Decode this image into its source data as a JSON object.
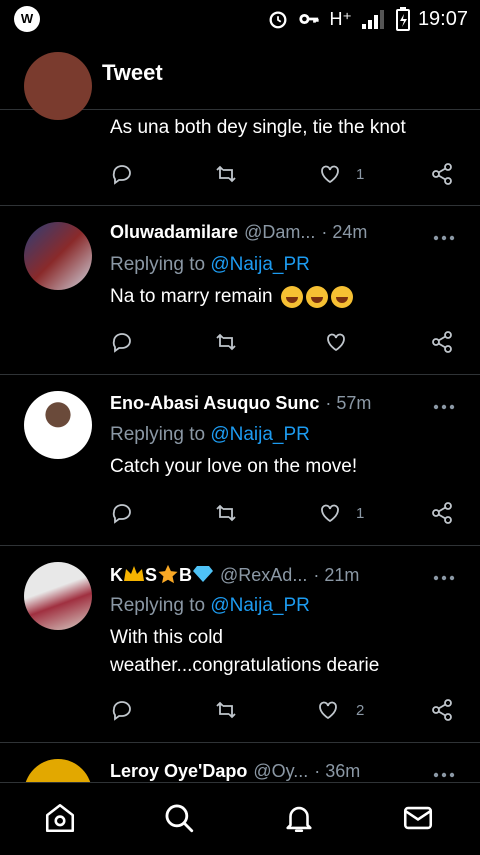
{
  "status": {
    "time": "19:07",
    "network": "H⁺",
    "app_badge": "W"
  },
  "header": {
    "title": "Tweet"
  },
  "partial_tweet": {
    "text": "As una both dey single, tie the knot",
    "like_count": "1"
  },
  "tweets": [
    {
      "name": "Oluwadamilare",
      "handle": "@Dam...",
      "time": "· 24m",
      "reply_prefix": "Replying to",
      "reply_to": "@Naija_PR",
      "text": "Na to marry remain",
      "like_count": ""
    },
    {
      "name": "Eno-Abasi Asuquo Sunc",
      "handle": "",
      "time": "· 57m",
      "reply_prefix": "Replying to",
      "reply_to": "@Naija_PR",
      "text": "Catch your love on the move!",
      "like_count": "1"
    },
    {
      "name_parts": [
        "K",
        "S",
        "B"
      ],
      "handle": "@RexAd...",
      "time": "· 21m",
      "reply_prefix": "Replying to",
      "reply_to": "@Naija_PR",
      "text": "With this cold weather...congratulations dearie",
      "like_count": "2"
    },
    {
      "name": "Leroy Oye'Dapo",
      "handle": "@Oy...",
      "time": "· 36m"
    }
  ],
  "colors": {
    "background": "#000000",
    "accent": "#1d9bf0",
    "muted": "#8b98a5",
    "divider": "#2f3336"
  },
  "icons": [
    "back-arrow-icon",
    "reply-icon",
    "retweet-icon",
    "like-icon",
    "share-icon",
    "more-icon",
    "home-icon",
    "search-icon",
    "notifications-icon",
    "messages-icon"
  ]
}
